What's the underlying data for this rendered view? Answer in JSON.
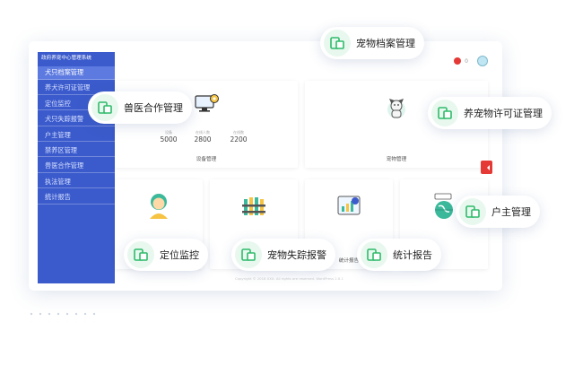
{
  "app": {
    "title": "政府养宠中心管理系统",
    "sidebar_items": [
      "犬只档案管理",
      "养犬许可证管理",
      "定位监控",
      "犬只失踪报警",
      "户主管理",
      "禁养区管理",
      "兽医合作管理",
      "执法管理",
      "统计报告"
    ],
    "active_index": 0,
    "notification_count": "0",
    "device_card": {
      "title": "设备管理",
      "stats": [
        {
          "label": "设备",
          "value": "5000"
        },
        {
          "label": "在线人数",
          "value": "2800"
        },
        {
          "label": "在线数",
          "value": "2200"
        }
      ]
    },
    "pet_card_title": "宠物管理",
    "bottom_card_titles": [
      "",
      "",
      "统计报告",
      ""
    ],
    "footer": "Copyright © 2018 XXX. All rights are reserved. WordPress 2.8.1"
  },
  "callouts": [
    "宠物档案管理",
    "兽医合作管理",
    "养宠物许可证管理",
    "户主管理",
    "定位监控",
    "宠物失踪报警",
    "统计报告"
  ],
  "colors": {
    "sidebar": "#3b5bcc",
    "accent_green": "#2fbb6a",
    "alert_red": "#e53935"
  }
}
